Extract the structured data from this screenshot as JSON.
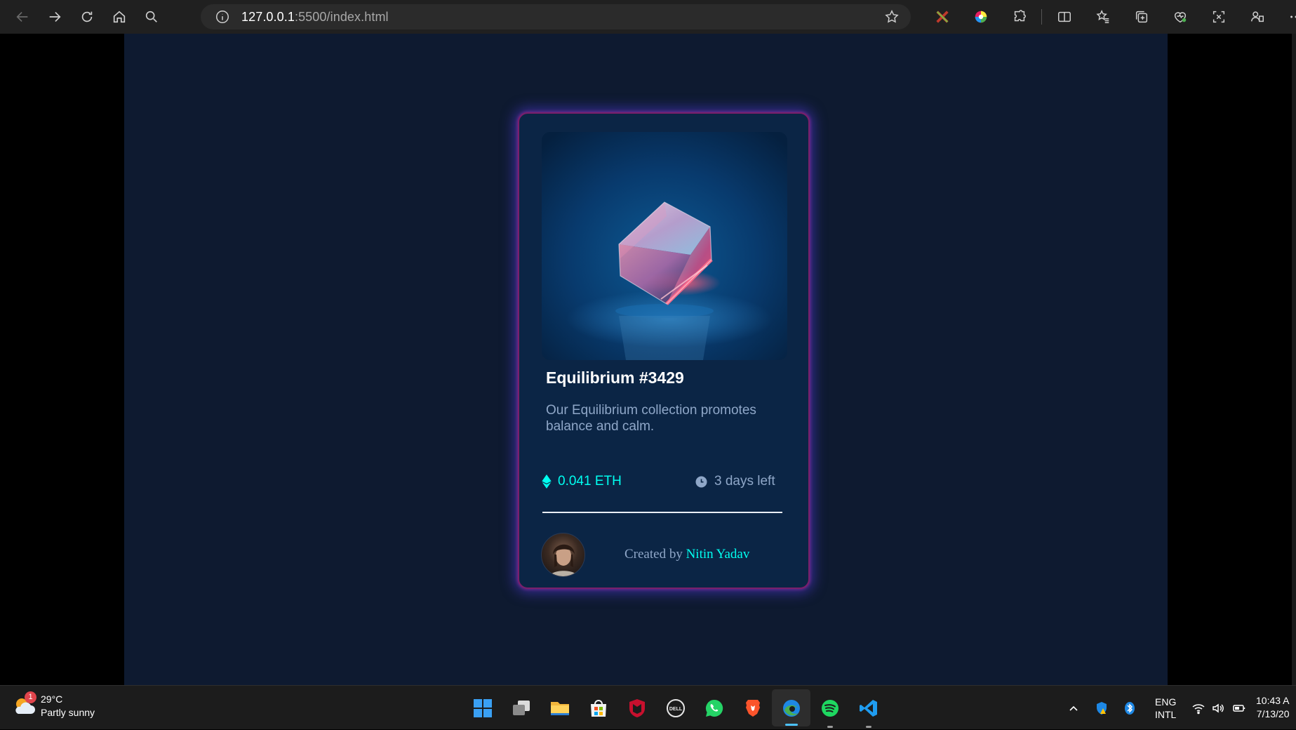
{
  "browser": {
    "url_host": "127.0.0.1",
    "url_path": ":5500/index.html"
  },
  "card": {
    "title": "Equilibrium #3429",
    "description": "Our Equilibrium collection promotes balance and calm.",
    "price": "0.041 ETH",
    "time_left": "3 days left",
    "created_by_prefix": "Created by",
    "creator_name": "Nitin Yadav"
  },
  "colors": {
    "page_bg": "#0e1a30",
    "card_bg": "#0b2545",
    "accent_cyan": "#00fff0",
    "muted_text": "#8fa7c8",
    "card_border": "#7a1f6a"
  },
  "taskbar": {
    "weather_temp": "29°C",
    "weather_desc": "Partly sunny",
    "weather_badge": "1",
    "lang_top": "ENG",
    "lang_bottom": "INTL",
    "time": "10:43 A",
    "date": "7/13/20"
  },
  "icons": {
    "browser": [
      "back-arrow-icon",
      "forward-arrow-icon",
      "refresh-icon",
      "home-icon",
      "search-icon",
      "info-icon",
      "star-icon"
    ],
    "toolbar": [
      "extension-x-icon",
      "color-wheel-icon",
      "puzzle-icon",
      "split-screen-icon",
      "favorites-icon",
      "collections-icon",
      "browser-essentials-icon",
      "screenshot-icon",
      "profile-icon",
      "more-icon"
    ],
    "taskbar_apps": [
      "windows-start-icon",
      "task-view-icon",
      "file-explorer-icon",
      "store-icon",
      "mcafee-icon",
      "dell-icon",
      "whatsapp-icon",
      "brave-icon",
      "edge-icon",
      "spotify-icon",
      "vscode-icon"
    ]
  }
}
